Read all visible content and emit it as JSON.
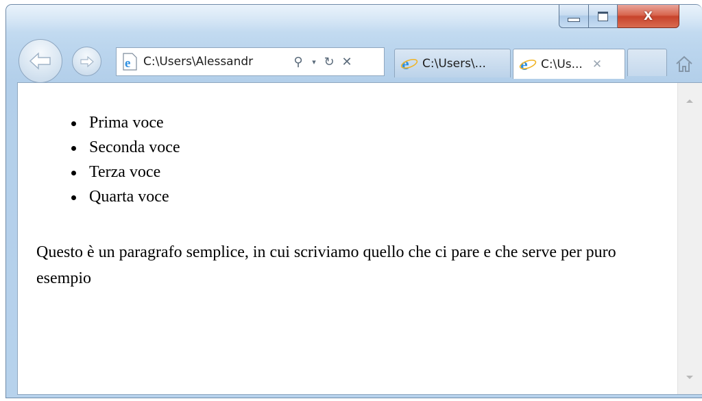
{
  "window": {
    "minimize_icon": "minimize-icon",
    "maximize_icon": "maximize-icon",
    "close_symbol": "X"
  },
  "toolbar": {
    "address": "C:\\Users\\Alessandr",
    "search_symbol": "⚲",
    "dropdown_symbol": "▾",
    "refresh_symbol": "↻",
    "stop_symbol": "✕"
  },
  "tabs": [
    {
      "label": "C:\\Users\\...",
      "active": false
    },
    {
      "label": "C:\\Us...",
      "active": true,
      "close_symbol": "✕"
    }
  ],
  "page": {
    "list_items": [
      "Prima voce",
      "Seconda voce",
      "Terza voce",
      "Quarta voce"
    ],
    "paragraph": "Questo è un paragrafo semplice, in cui scriviamo quello che ci pare e che serve per puro esempio"
  },
  "colors": {
    "frame": "#b7d2ec",
    "close_button": "#c7432c",
    "ie_logo": "#2f8fe0"
  }
}
